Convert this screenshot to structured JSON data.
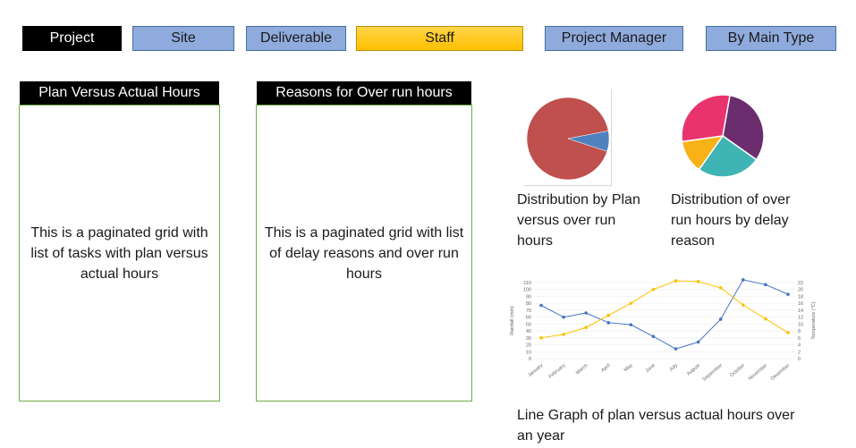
{
  "tabs": [
    {
      "label": "Project"
    },
    {
      "label": "Site"
    },
    {
      "label": "Deliverable"
    },
    {
      "label": "Staff"
    },
    {
      "label": "Project Manager"
    },
    {
      "label": "By Main Type"
    }
  ],
  "panels": {
    "plan_vs_actual": {
      "title": "Plan Versus Actual Hours",
      "body": "This is a paginated grid with list of tasks with plan versus actual hours"
    },
    "over_run_reasons": {
      "title": "Reasons for Over run hours",
      "body": "This is a paginated grid with list of delay reasons and over run hours"
    }
  },
  "captions": {
    "pie1": "Distribution by Plan versus over run hours",
    "pie2": "Distribution of over run hours by delay reason",
    "line": "Line Graph of plan versus actual hours over an year"
  },
  "chart_data": [
    {
      "type": "pie",
      "slices": [
        {
          "value": 92,
          "color": "#c0504d"
        },
        {
          "value": 8,
          "color": "#4f81bd"
        }
      ]
    },
    {
      "type": "pie",
      "slices": [
        {
          "value": 32,
          "color": "#6b2d6e"
        },
        {
          "value": 25,
          "color": "#3fb4b4"
        },
        {
          "value": 13,
          "color": "#f9b118"
        },
        {
          "value": 30,
          "color": "#e8336e"
        }
      ]
    },
    {
      "type": "line",
      "categories": [
        "January",
        "February",
        "March",
        "April",
        "May",
        "June",
        "July",
        "August",
        "September",
        "October",
        "November",
        "December"
      ],
      "ylabel": "Rainfall (mm)",
      "y2label": "Temperature (°C)",
      "yticks": [
        0,
        10,
        20,
        30,
        40,
        50,
        60,
        70,
        80,
        90,
        100,
        110
      ],
      "y2ticks": [
        0,
        2,
        4,
        6,
        8,
        10,
        12,
        14,
        16,
        18,
        20,
        22
      ],
      "ylim": [
        0,
        110
      ],
      "y2lim": [
        0,
        22
      ],
      "series": [
        {
          "axis": "left",
          "color": "#4472c4",
          "values": [
            77,
            60,
            66,
            52,
            49,
            32,
            14,
            24,
            57,
            114,
            107,
            93
          ]
        },
        {
          "axis": "right",
          "color": "#ffc000",
          "values": [
            6,
            7,
            9,
            12.5,
            16,
            20,
            22.5,
            22.3,
            20.5,
            15.5,
            11.5,
            7.5
          ]
        }
      ]
    }
  ]
}
